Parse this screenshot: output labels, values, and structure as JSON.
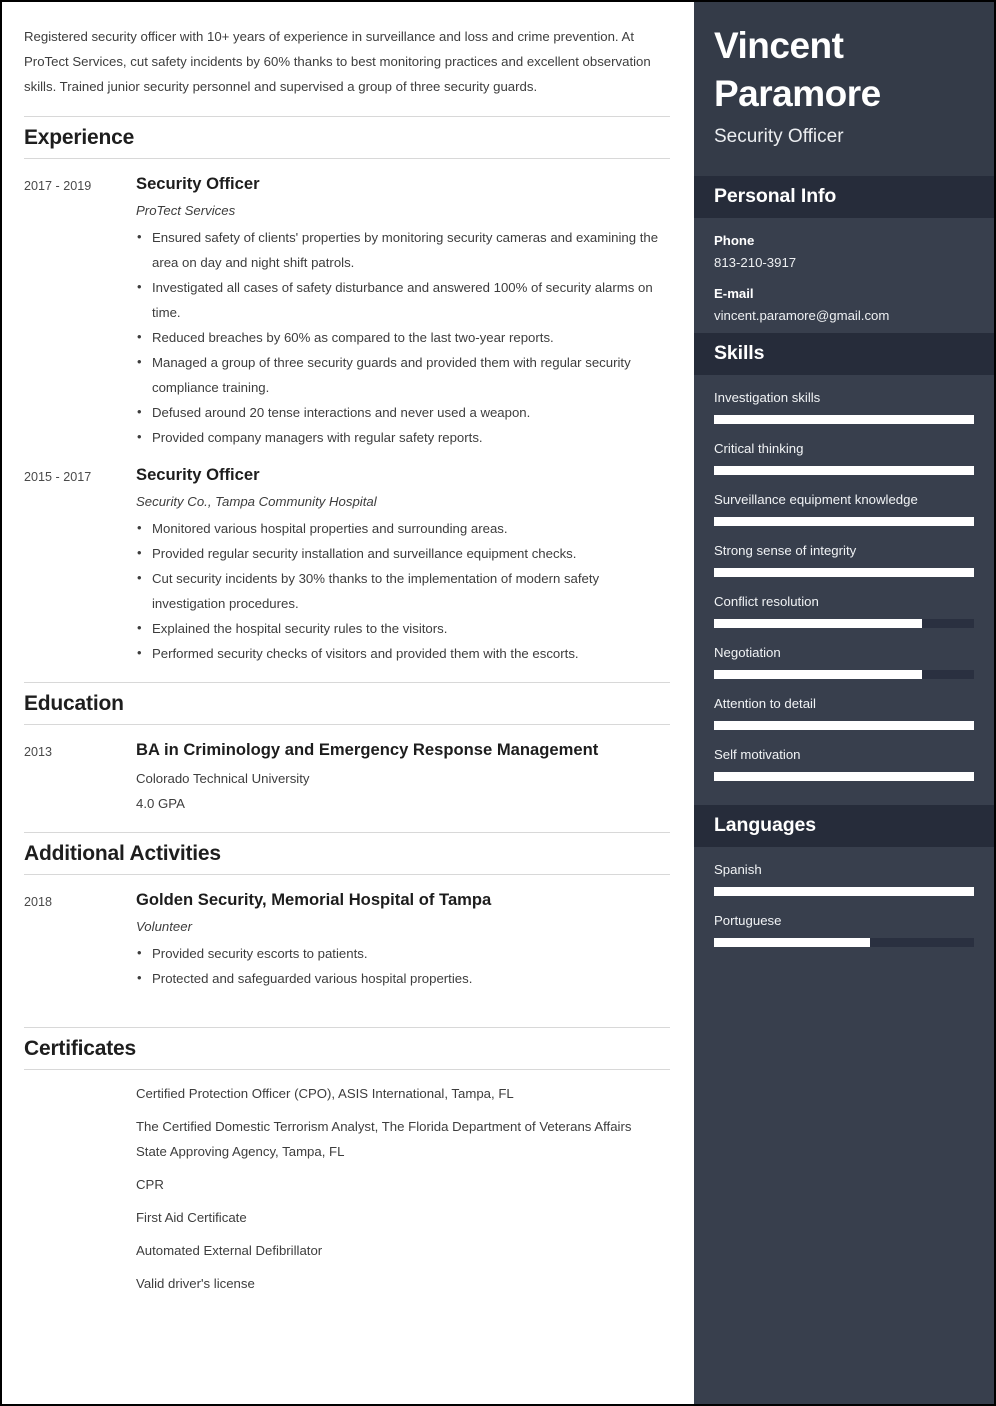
{
  "colors": {
    "sidebar_bg": "#383f4d",
    "sidebar_top_bg": "#343b48",
    "sidebar_header_bg": "#262c3a",
    "bar_fill": "#ffffff",
    "bar_track": "#2a3040",
    "page_border": "#000000",
    "rule": "#d8d8d8"
  },
  "main": {
    "summary": "Registered security officer with 10+ years of experience in surveillance and loss and crime prevention. At ProTect Services, cut safety incidents by 60% thanks to best monitoring practices and excellent observation skills. Trained junior security personnel and supervised a group of three security guards.",
    "sections": {
      "experience": {
        "title": "Experience",
        "entries": [
          {
            "date": "2017 - 2019",
            "title": "Security Officer",
            "subtitle": "ProTect Services",
            "bullets": [
              "Ensured safety of clients' properties by monitoring security cameras and examining the area on day and night shift patrols.",
              "Investigated all cases of safety disturbance and answered 100% of security alarms on time.",
              "Reduced breaches by 60% as compared to the last two-year reports.",
              "Managed a group of three security guards and provided them with regular security compliance training.",
              "Defused around 20 tense interactions and never used a weapon.",
              "Provided company managers with regular safety reports."
            ]
          },
          {
            "date": "2015 - 2017",
            "title": "Security Officer",
            "subtitle": "Security Co., Tampa Community Hospital",
            "bullets": [
              "Monitored various hospital properties and surrounding areas.",
              "Provided regular security installation and surveillance equipment checks.",
              "Cut security incidents by 30% thanks to the implementation of modern safety investigation procedures.",
              "Explained the hospital security rules to the visitors.",
              "Performed security checks of visitors and provided them with the escorts."
            ]
          }
        ]
      },
      "education": {
        "title": "Education",
        "entries": [
          {
            "date": "2013",
            "title": "BA in Criminology and Emergency Response Management",
            "school": "Colorado Technical University",
            "gpa": "4.0 GPA"
          }
        ]
      },
      "additional_activities": {
        "title": "Additional Activities",
        "entries": [
          {
            "date": "2018",
            "title": "Golden Security, Memorial Hospital of Tampa",
            "subtitle": "Volunteer",
            "bullets": [
              "Provided security escorts to patients.",
              "Protected and safeguarded various hospital properties."
            ]
          }
        ]
      },
      "certificates": {
        "title": "Certificates",
        "items": [
          "Certified Protection Officer (CPO), ASIS International, Tampa, FL",
          "The Certified Domestic Terrorism Analyst, The Florida Department of Veterans Affairs State Approving Agency, Tampa, FL",
          "CPR",
          "First Aid Certificate",
          "Automated External Defibrillator",
          "Valid driver's license"
        ]
      }
    }
  },
  "sidebar": {
    "name": "Vincent Paramore",
    "role": "Security Officer",
    "personal_info": {
      "header": "Personal Info",
      "fields": [
        {
          "label": "Phone",
          "value": "813-210-3917"
        },
        {
          "label": "E-mail",
          "value": "vincent.paramore@gmail.com"
        }
      ]
    },
    "skills": {
      "header": "Skills",
      "items": [
        {
          "label": "Investigation skills",
          "level": 100
        },
        {
          "label": "Critical thinking",
          "level": 100
        },
        {
          "label": "Surveillance equipment knowledge",
          "level": 100
        },
        {
          "label": "Strong sense of integrity",
          "level": 100
        },
        {
          "label": "Conflict resolution",
          "level": 80
        },
        {
          "label": "Negotiation",
          "level": 80
        },
        {
          "label": "Attention to detail",
          "level": 100
        },
        {
          "label": "Self motivation",
          "level": 100
        }
      ]
    },
    "languages": {
      "header": "Languages",
      "items": [
        {
          "label": "Spanish",
          "level": 100
        },
        {
          "label": "Portuguese",
          "level": 60
        }
      ]
    }
  }
}
